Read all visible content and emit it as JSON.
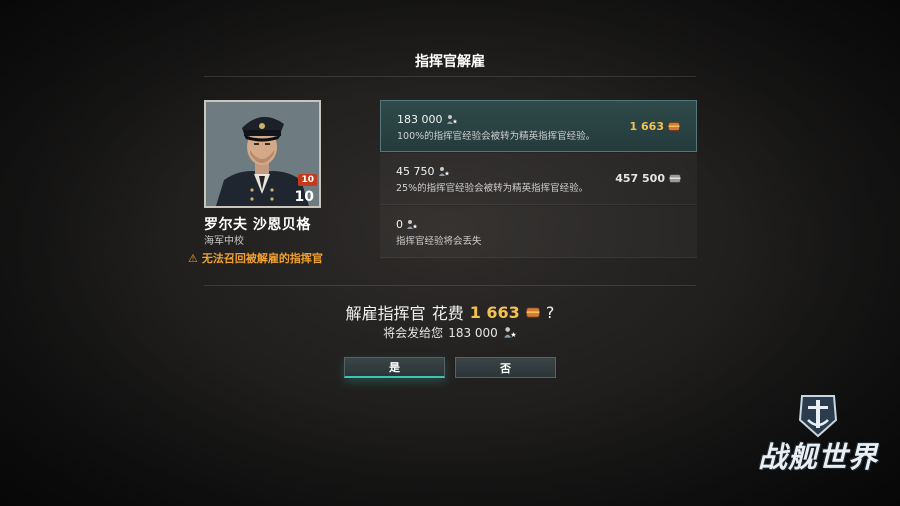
{
  "dialog": {
    "title": "指挥官解雇"
  },
  "commander": {
    "name": "罗尔夫  沙恩贝格",
    "rank": "海军中校",
    "level_badge": "10",
    "level": "10",
    "warning": "无法召回被解雇的指挥官",
    "warning_icon": "warning-triangle-icon"
  },
  "options": [
    {
      "xp": "183 000",
      "description": "100%的指挥官经验会被转为精英指挥官经验。",
      "cost": "1 663",
      "currency": "doubloon",
      "selected": true
    },
    {
      "xp": "45 750",
      "description": "25%的指挥官经验会被转为精英指挥官经验。",
      "cost": "457 500",
      "currency": "credits",
      "selected": false
    },
    {
      "xp": "0",
      "description": "指挥官经验将会丢失",
      "cost": "",
      "currency": "",
      "selected": false
    }
  ],
  "confirm": {
    "prefix": "解雇指挥官",
    "cost_label": "花费",
    "cost": "1 663",
    "suffix": "?",
    "grant_label": "将会发给您",
    "grant_xp": "183 000"
  },
  "buttons": {
    "yes": "是",
    "no": "否"
  },
  "logo": {
    "text": "战舰世界"
  },
  "colors": {
    "gold": "#f3c152",
    "warning": "#f0a030",
    "accent": "#3cc4b3",
    "badge": "#c63a1b"
  }
}
